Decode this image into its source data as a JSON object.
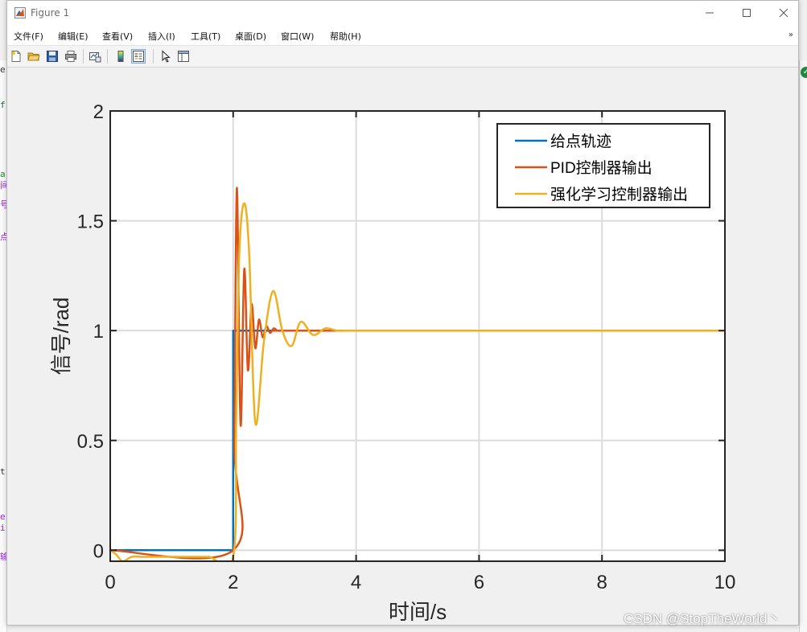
{
  "window": {
    "title": "Figure 1"
  },
  "menu": {
    "items": [
      "文件(F)",
      "编辑(E)",
      "查看(V)",
      "插入(I)",
      "工具(T)",
      "桌面(D)",
      "窗口(W)",
      "帮助(H)"
    ],
    "overflow_glyph": "»"
  },
  "toolbar": {
    "buttons": [
      "new-figure-icon",
      "open-file-icon",
      "save-icon",
      "print-icon",
      "link-plot-icon",
      "colorbar-icon",
      "legend-icon",
      "pointer-icon",
      "property-inspector-icon"
    ]
  },
  "colors": {
    "series1": "#0072BD",
    "series2": "#D95319",
    "series3": "#EDB120",
    "axes": "#262626",
    "grid": "#dcdcdc"
  },
  "chart_data": {
    "type": "line",
    "xlabel": "时间/s",
    "ylabel": "信号/rad",
    "xlim": [
      0,
      10
    ],
    "ylim": [
      -0.05,
      2
    ],
    "xticks": [
      0,
      2,
      4,
      6,
      8,
      10
    ],
    "yticks": [
      0,
      0.5,
      1,
      1.5,
      2
    ],
    "xtick_labels": [
      "0",
      "2",
      "4",
      "6",
      "8",
      "10"
    ],
    "ytick_labels": [
      "0",
      "0.5",
      "1",
      "1.5",
      "2"
    ],
    "grid": true,
    "legend_position": "top-right",
    "series": [
      {
        "name": "给点轨迹",
        "x": [
          0,
          2,
          2,
          10
        ],
        "y": [
          0,
          0,
          1,
          1
        ]
      },
      {
        "name": "PID控制器输出",
        "x": [
          0,
          2.0,
          2.02,
          2.06,
          2.12,
          2.18,
          2.24,
          2.3,
          2.36,
          2.42,
          2.48,
          2.54,
          2.6,
          2.66,
          2.72,
          2.8,
          2.9,
          3.0,
          3.2,
          10
        ],
        "y": [
          0,
          0,
          0.5,
          1.65,
          0.57,
          1.28,
          0.82,
          1.12,
          0.92,
          1.05,
          0.97,
          1.02,
          0.99,
          1.01,
          1.0,
          1.0,
          1.0,
          1.0,
          1.0,
          1.0
        ]
      },
      {
        "name": "强化学习控制器输出",
        "x": [
          0,
          0.1,
          0.2,
          0.35,
          0.5,
          0.8,
          1.2,
          1.6,
          2.0,
          2.05,
          2.1,
          2.18,
          2.26,
          2.36,
          2.5,
          2.65,
          2.8,
          2.95,
          3.1,
          3.3,
          3.5,
          3.7,
          4.0,
          4.3,
          10
        ],
        "y": [
          0,
          -0.02,
          -0.05,
          -0.03,
          -0.03,
          -0.03,
          -0.03,
          -0.03,
          -0.03,
          0.6,
          1.35,
          1.58,
          1.35,
          0.58,
          0.95,
          1.18,
          1.0,
          0.93,
          1.04,
          0.98,
          1.01,
          1.0,
          1.0,
          1.0,
          1.0
        ]
      }
    ]
  },
  "watermark": "CSDN @StopTheWorld丶"
}
